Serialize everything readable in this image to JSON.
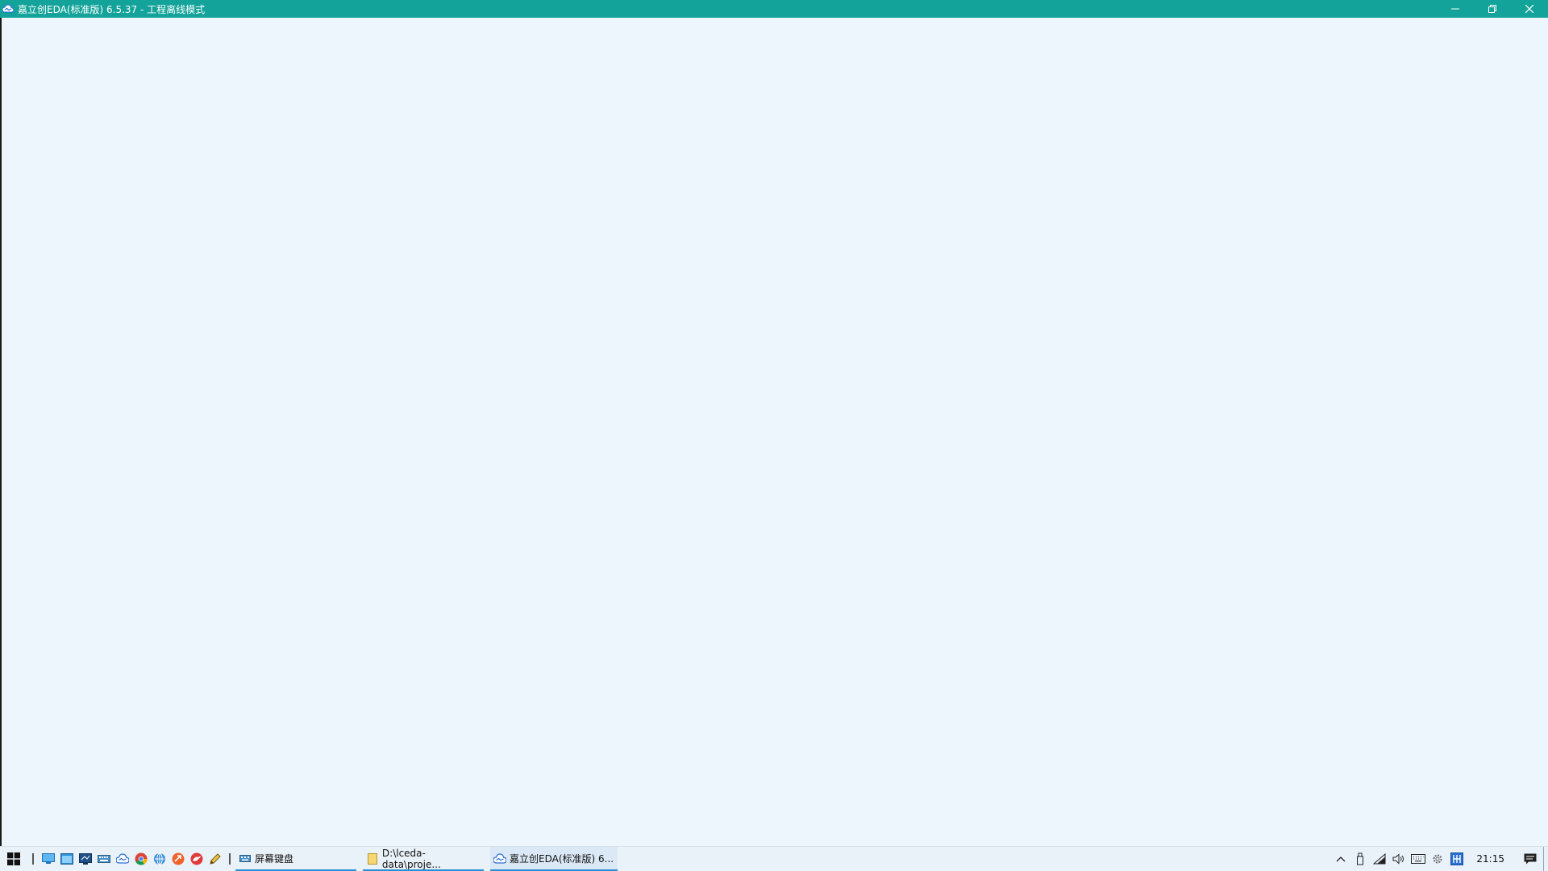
{
  "window": {
    "title": "嘉立创EDA(标准版) 6.5.37 - 工程离线模式",
    "app_icon": "easyeda-cloud-icon",
    "controls": [
      "minimize-icon",
      "restore-icon",
      "close-icon"
    ]
  },
  "colors": {
    "titlebar": "#13a39a",
    "client_bg": "#eef6fd",
    "taskbar_bg": "#eaf2f9",
    "task_underline": "#2a8fd4"
  },
  "taskbar": {
    "quick_launch": [
      "desktop-icon",
      "window-icon",
      "remote-desktop-icon",
      "keyboard-icon",
      "easyeda-icon",
      "chrome-icon",
      "network-icon",
      "arrow-app-icon",
      "bird-app-icon",
      "pencil-icon"
    ],
    "tasks": [
      {
        "label": "屏幕键盘",
        "icon": "keyboard-icon"
      },
      {
        "label": "D:\\lceda-data\\proje...",
        "icon": "folder-icon"
      },
      {
        "label": "嘉立创EDA(标准版) 6...",
        "icon": "easyeda-cloud-icon"
      }
    ],
    "tray": [
      "chevron-up-icon",
      "usb-icon",
      "wifi-icon",
      "volume-icon",
      "keyboard-icon",
      "gear-icon",
      "input-method-icon"
    ],
    "clock": "21:15",
    "notification_icon": "notification-icon"
  }
}
